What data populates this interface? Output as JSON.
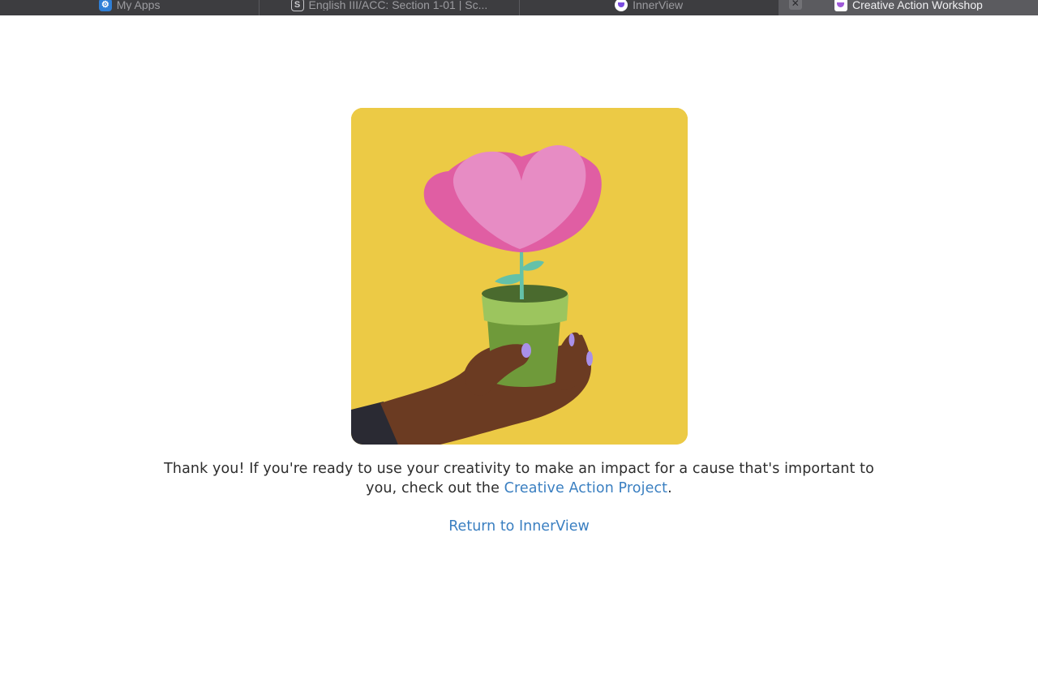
{
  "browser": {
    "tabs": [
      {
        "label": "My Apps",
        "icon": "apps-icon",
        "active": false
      },
      {
        "label": "English III/ACC: Section 1-01 | Sc...",
        "icon": "s-letter-icon",
        "active": false
      },
      {
        "label": "InnerView",
        "icon": "innerview-logo-icon",
        "active": false
      },
      {
        "label": "Creative Action Workshop",
        "icon": "creative-action-logo-icon",
        "active": true
      }
    ],
    "close_glyph": "✕"
  },
  "content": {
    "illustration": {
      "icon": "hand-holding-flower-pot-illustration",
      "colors": {
        "background": "#ecca45",
        "petal_outer": "#e05ea3",
        "petal_inner": "#e78cc4",
        "pot": "#8fb558",
        "hand": "#6b3b22",
        "nails": "#a990e8"
      }
    },
    "message": {
      "before_link": "Thank you! If you're ready to use your creativity to make an impact for a cause that's important to you, check out the ",
      "link_text": "Creative Action Project",
      "after_link": "."
    },
    "return_link": "Return to InnerView"
  },
  "colors": {
    "link": "#3a7fc1",
    "text": "#2d2d2d",
    "tabbar": "#3d3d40"
  }
}
